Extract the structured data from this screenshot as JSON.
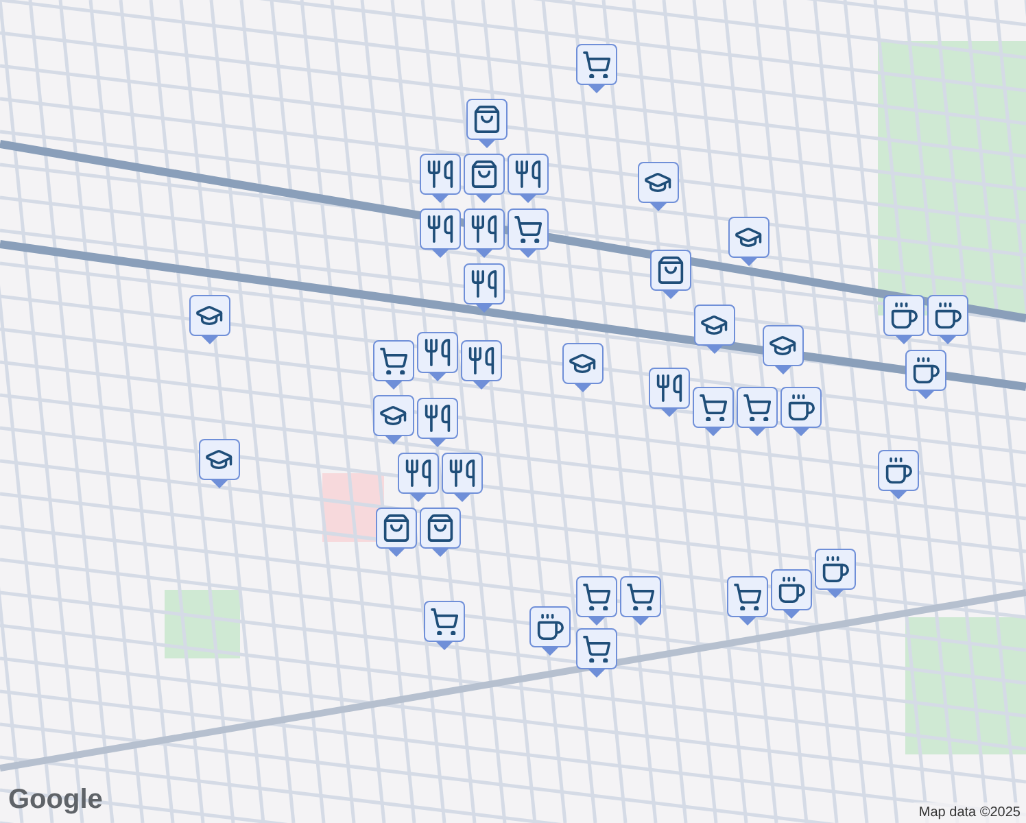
{
  "map": {
    "markers": [
      {
        "kind": "shopping"
      },
      {
        "kind": "grocery"
      },
      {
        "kind": "school"
      },
      {
        "kind": "school"
      },
      {
        "kind": "shopping"
      },
      {
        "kind": "school"
      },
      {
        "kind": "school"
      },
      {
        "kind": "cafe"
      },
      {
        "kind": "cafe"
      },
      {
        "kind": "cafe"
      },
      {
        "kind": "restaurant"
      },
      {
        "kind": "grocery"
      },
      {
        "kind": "grocery"
      },
      {
        "kind": "cafe"
      },
      {
        "kind": "school"
      },
      {
        "kind": "restaurant"
      },
      {
        "kind": "shopping"
      },
      {
        "kind": "restaurant"
      },
      {
        "kind": "restaurant"
      },
      {
        "kind": "restaurant"
      },
      {
        "kind": "grocery"
      },
      {
        "kind": "restaurant"
      },
      {
        "kind": "grocery"
      },
      {
        "kind": "restaurant"
      },
      {
        "kind": "restaurant"
      },
      {
        "kind": "school"
      },
      {
        "kind": "restaurant"
      },
      {
        "kind": "restaurant"
      },
      {
        "kind": "restaurant"
      },
      {
        "kind": "shopping"
      },
      {
        "kind": "shopping"
      },
      {
        "kind": "school"
      },
      {
        "kind": "school"
      },
      {
        "kind": "cafe"
      },
      {
        "kind": "grocery"
      },
      {
        "kind": "grocery"
      },
      {
        "kind": "cafe"
      },
      {
        "kind": "grocery"
      },
      {
        "kind": "grocery"
      },
      {
        "kind": "grocery"
      },
      {
        "kind": "cafe"
      },
      {
        "kind": "cafe"
      }
    ]
  },
  "logo": "Google",
  "attribution": "Map data ©2025"
}
